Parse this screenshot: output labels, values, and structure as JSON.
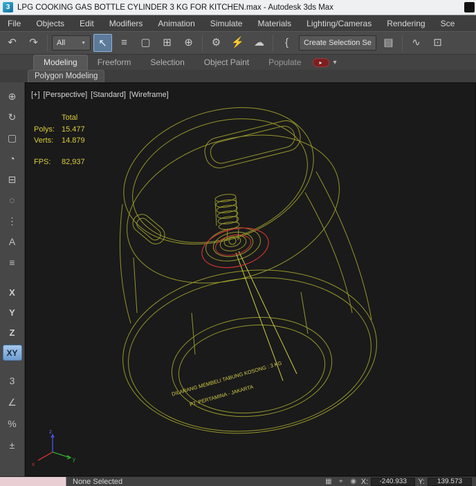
{
  "title_bar": {
    "title": "LPG COOKING GAS BOTTLE CYLINDER  3 KG FOR KITCHEN.max - Autodesk 3ds Max"
  },
  "icons": {
    "app_glyph": "3",
    "combo_arrow": "▼",
    "flyout_arrow": "▾",
    "populate_badge": "▸"
  },
  "menu_bar": {
    "items": [
      {
        "label": "File"
      },
      {
        "label": "Objects"
      },
      {
        "label": "Edit"
      },
      {
        "label": "Modifiers"
      },
      {
        "label": "Animation"
      },
      {
        "label": "Simulate"
      },
      {
        "label": "Materials"
      },
      {
        "label": "Lighting/Cameras"
      },
      {
        "label": "Rendering"
      },
      {
        "label": "Sce"
      }
    ]
  },
  "main_toolbar": {
    "undo_glyph": "↶",
    "redo_glyph": "↷",
    "filter_combo": "All",
    "select_icons": [
      {
        "glyph": "↖"
      },
      {
        "glyph": "≡"
      },
      {
        "glyph": "▢"
      },
      {
        "glyph": "⊞"
      },
      {
        "glyph": "⊕"
      }
    ],
    "mid_icons": [
      {
        "glyph": "⚙"
      },
      {
        "glyph": "⚡"
      },
      {
        "glyph": "☁"
      }
    ],
    "named_sets_glyph": "{",
    "selection_set_combo": "Create Selection Se",
    "right_icons": [
      {
        "glyph": "▤"
      },
      {
        "glyph": "∿"
      },
      {
        "glyph": "⊡"
      }
    ]
  },
  "ribbon": {
    "tabs": [
      {
        "label": "Modeling"
      },
      {
        "label": "Freeform"
      },
      {
        "label": "Selection"
      },
      {
        "label": "Object Paint"
      },
      {
        "label": "Populate"
      }
    ],
    "subtab": "Polygon Modeling"
  },
  "left_toolbar": {
    "icons": [
      {
        "glyph": "⊕"
      },
      {
        "glyph": "↻"
      },
      {
        "glyph": "▢"
      },
      {
        "glyph": "◔"
      },
      {
        "glyph": "⊟"
      },
      {
        "glyph": "◌"
      },
      {
        "glyph": "⋮"
      },
      {
        "glyph": "A"
      },
      {
        "glyph": "≡"
      }
    ],
    "axis_x": "X",
    "axis_y": "Y",
    "axis_z": "Z",
    "axis_xy": "XY",
    "snaps": [
      {
        "glyph": "3"
      },
      {
        "glyph": "∠"
      },
      {
        "glyph": "%"
      },
      {
        "glyph": "±"
      }
    ]
  },
  "viewport": {
    "label_plus": "[+]",
    "label_view": "[Perspective]",
    "label_standard": "[Standard]",
    "label_shading": "[Wireframe]",
    "stats": {
      "total_label": "Total",
      "polys_label": "Polys:",
      "polys_value": "15.477",
      "verts_label": "Verts:",
      "verts_value": "14.879",
      "fps_label": "FPS:",
      "fps_value": "82,937"
    },
    "model_text_line1": "DILARANG MEMBELI TABUNG KOSONG : 3 KG",
    "model_text_line2": "PT. PERTAMINA - JAKARTA",
    "axis_gizmo": {
      "x": "x",
      "y": "y",
      "z": "z"
    },
    "colors": {
      "wireframe": "#96962c",
      "wireframe_bright": "#cfcf46",
      "selection_red": "#c23030",
      "stats_yellow": "#d9cd3d"
    }
  },
  "status_bar": {
    "selection_status": "None Selected",
    "x_label": "X:",
    "x_value": "-240.933",
    "y_label": "Y:",
    "y_value": "139.573"
  }
}
